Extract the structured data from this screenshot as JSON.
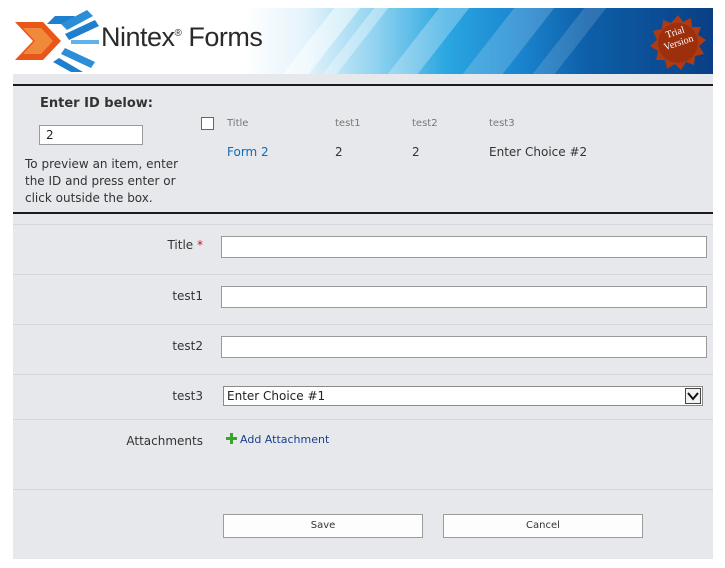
{
  "header": {
    "brand": "Nintex",
    "brand_mark": "®",
    "brand_product": "Forms",
    "trial_badge_line1": "Trial",
    "trial_badge_line2": "Version",
    "colors": {
      "badge": "#b23a12",
      "accent": "#1b86d0",
      "logo_orange": "#e8561a",
      "logo_blue": "#1e7fcf"
    }
  },
  "preview": {
    "label": "Enter ID below:",
    "id_value": "2",
    "help": "To preview an item, enter the ID and press enter or click outside the box.",
    "columns": [
      "Title",
      "test1",
      "test2",
      "test3"
    ],
    "rows": [
      [
        "Form 2",
        "2",
        "2",
        "Enter Choice #2"
      ]
    ]
  },
  "form": {
    "title_label": "Title",
    "required_marker": "*",
    "test1_label": "test1",
    "test2_label": "test2",
    "test3_label": "test3",
    "test3_selected": "Enter Choice #1",
    "attachments_label": "Attachments",
    "add_attachment": "Add Attachment",
    "title_value": "",
    "test1_value": "",
    "test2_value": ""
  },
  "actions": {
    "save": "Save",
    "cancel": "Cancel"
  },
  "icons": {
    "logo": "nintex-logo-icon",
    "badge": "trial-badge-icon",
    "plus": "plus-icon",
    "dropdown": "chevron-down-icon"
  }
}
